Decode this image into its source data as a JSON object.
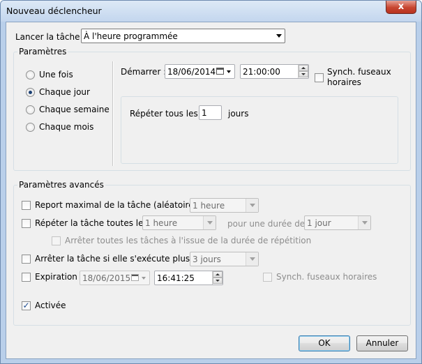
{
  "window": {
    "title": "Nouveau déclencheur",
    "close_glyph": "x"
  },
  "launch": {
    "label": "Lancer la tâche :",
    "value": "À l'heure programmée"
  },
  "params": {
    "title": "Paramètres",
    "radios": [
      {
        "label": "Une fois",
        "checked": false
      },
      {
        "label": "Chaque jour",
        "checked": true
      },
      {
        "label": "Chaque semaine",
        "checked": false
      },
      {
        "label": "Chaque mois",
        "checked": false
      }
    ],
    "start_label": "Démarrer :",
    "start_date": "18/06/2014",
    "start_time": "21:00:00",
    "sync_label_line1": "Synch. fuseaux",
    "sync_label_line2": "horaires",
    "repeat_label": "Répéter tous les :",
    "repeat_value": "1",
    "repeat_unit": "jours"
  },
  "advanced": {
    "title": "Paramètres avancés",
    "delay_label": "Report maximal de la tâche (aléatoire) :",
    "delay_value": "1 heure",
    "repeat_label": "Répéter la tâche toutes les :",
    "repeat_value": "1 heure",
    "duration_label": "pour une durée de :",
    "duration_value": "1 jour",
    "stop_all_label": "Arrêter toutes les tâches à l'issue de la durée de répétition",
    "stop_label": "Arrêter la tâche si elle s'exécute plus de :",
    "stop_value": "3 jours",
    "expire_label": "Expiration :",
    "expire_date": "18/06/2015",
    "expire_time": "16:41:25",
    "expire_sync_label": "Synch. fuseaux horaires",
    "enabled_label": "Activée",
    "enabled_checked": true
  },
  "buttons": {
    "ok": "OK",
    "cancel": "Annuler"
  },
  "icons": {
    "check": "✓",
    "calendar": "calendar-icon"
  }
}
